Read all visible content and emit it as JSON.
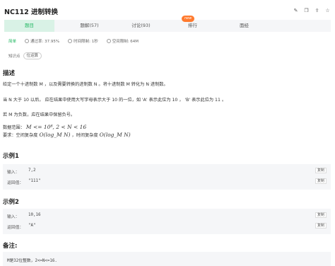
{
  "header": {
    "title": "NC112  进制转换",
    "icons": [
      "edit-icon",
      "copy-icon",
      "share-icon",
      "star-icon"
    ]
  },
  "tabs": [
    {
      "label": "题目",
      "active": true
    },
    {
      "label": "题解(57)",
      "active": false
    },
    {
      "label": "讨论(93)",
      "active": false
    },
    {
      "label": "排行",
      "active": false
    },
    {
      "label": "面经",
      "active": false
    }
  ],
  "badge": "new",
  "meta": {
    "difficulty": "简单",
    "pass_rate": "通过率: 37.95%",
    "time_limit": "时间限制: 1秒",
    "space_limit": "空间限制: 64M"
  },
  "knowledge": {
    "label": "知识点",
    "tag": "位运算"
  },
  "description": {
    "title": "描述",
    "p1": "给定一个十进制数 M ，以及需要转换的进制数 N 。将十进制数 M 转化为 N 进制数。",
    "p2": "当 N 大于 10 以后， 应在结果中使用大写字母表示大于 10 的一位，如 'A' 表示此位为 10 ， 'B' 表示此位为 11 。",
    "p3": "若 M 为负数，应在结果中保留负号。",
    "range_label": "数据范围：",
    "range_math": "M <= 10⁸, 2 < N < 16",
    "req_label": "要求：空间复杂度",
    "req_math1": "O(log_M N)",
    "req_mid": "，时间复杂度",
    "req_math2": "O(log_M N)"
  },
  "examples": [
    {
      "title": "示例1",
      "input_label": "输入：",
      "input": "7,2",
      "output_label": "返回值：",
      "output": "\"111\"",
      "copy": "复制"
    },
    {
      "title": "示例2",
      "input_label": "输入：",
      "input": "10,16",
      "output_label": "返回值：",
      "output": "\"A\"",
      "copy": "复制"
    }
  ],
  "note": {
    "title": "备注:",
    "text": "M是32位整数，2<=N<=16."
  }
}
